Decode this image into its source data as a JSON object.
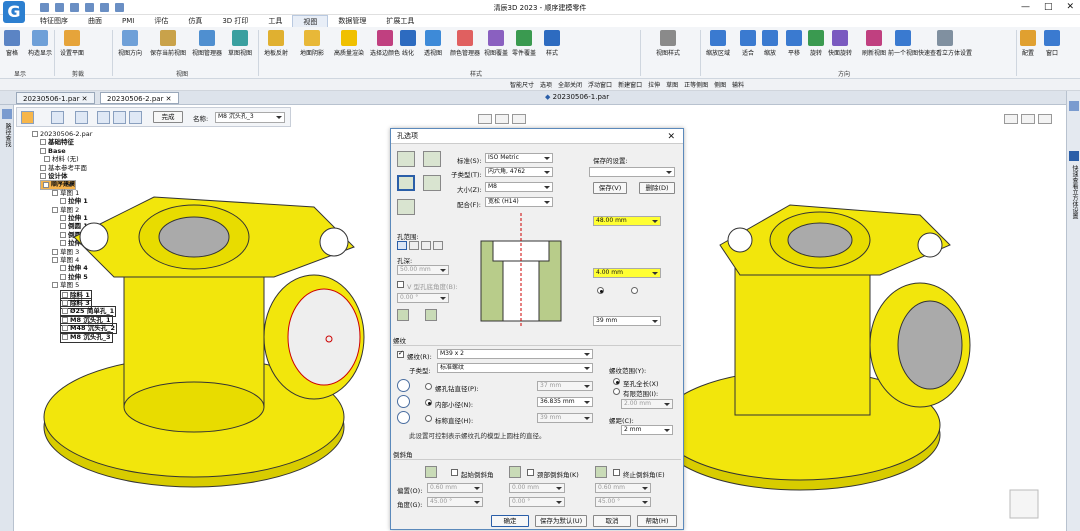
{
  "app": {
    "title": "清辰3D 2023 - 顺序建模零件",
    "logo": "G"
  },
  "tabs": [
    "特征图序",
    "曲面",
    "PMI",
    "评估",
    "仿真",
    "3D 打印",
    "工具",
    "视图",
    "数据管理",
    "扩展工具"
  ],
  "active_tab": "视图",
  "ribbon": {
    "buttons": [
      "窗格",
      "构造显示",
      "设置平面",
      "视图方向",
      "保存当前视图",
      "视图管理器",
      "草图视图",
      "地板反射",
      "地面阴影",
      "高质量渲染",
      "选择边颜色",
      "线化",
      "透视图",
      "颜色管理器",
      "视图覆盖",
      "零件覆盖",
      "样式",
      "视图样式",
      "缩放区域",
      "适合",
      "缩放",
      "平移",
      "旋转",
      "快面旋转",
      "刷新视图",
      "前一个视图",
      "快速查看立方体设置",
      "配置",
      "窗口"
    ],
    "groups": [
      "显示",
      "剪裁",
      "视图",
      "样式",
      "方向"
    ]
  },
  "cmdbar": [
    "智能尺寸",
    "选项",
    "全部关闭",
    "浮动窗口",
    "新建窗口",
    "拉伸",
    "草图",
    "正等侧图",
    "侧图",
    "输料"
  ],
  "doctabs": [
    "20230506-1.par",
    "20230506-2.par"
  ],
  "pathtool": {
    "done_label": "完成",
    "name_label": "名称:",
    "name_value": "M8 沉头孔_3"
  },
  "left_sidebar": "路径查找",
  "tree": [
    "20230506-2.par",
    "基础特征",
    "Base",
    "材料 (无)",
    "基本参考平面",
    "设计体",
    "顺序建模",
    "草图 1",
    "拉伸 1",
    "草图 2",
    "拉伸 1",
    "倒圆 1",
    "倒圆 2",
    "拉伸 2",
    "草图 3",
    "草图 4",
    "拉伸 4",
    "拉伸 5",
    "草图 5",
    "除料 1",
    "除料 3",
    "Ø25 简单孔_1",
    "M8 沉头孔_1",
    "M48 沉头孔_2",
    "M8 沉头孔_3"
  ],
  "view2_title": "20230506-1.par",
  "right_panel": "快速查看立方体设置",
  "dialog": {
    "title": "孔选项",
    "std_label": "标准(S):",
    "std_value": "ISO Metric",
    "subtype_label": "子类型(T):",
    "subtype_value": "内六角, 4762",
    "size_label": "大小(Z):",
    "size_value": "M8",
    "fit_label": "配合(F):",
    "fit_value": "宽松 (H14)",
    "saved_label": "保存的设置:",
    "save_btn": "保存(V)",
    "delete_btn": "删除(D)",
    "depth1": "48.00 mm",
    "depth2": "4.00 mm",
    "depth3": "39 mm",
    "range_label": "孔范围:",
    "depth_label": "孔深:",
    "depth_value": "50.00 mm",
    "vangle_label": "V 型孔底角度(B):",
    "vangle_value": "0.00 °",
    "thread_section": "螺纹",
    "thread_chk": "螺纹(R):",
    "thread_value": "M39 x 2",
    "thread_sub_label": "子类型:",
    "thread_sub_value": "标准螺纹",
    "tap_label": "螺孔钻直径(P):",
    "tap_value": "37 mm",
    "minor_label": "内部小径(N):",
    "minor_value": "36.835 mm",
    "nominal_label": "标称直径(H):",
    "nominal_value": "39 mm",
    "note": "此设置可控制表示螺纹孔的模型上圆柱的直径。",
    "thread_range_label": "螺纹范围(Y):",
    "full_label": "至孔全长(X)",
    "finite_label": "有限范围(I):",
    "finite_value": "2.00 mm",
    "pitch_label": "螺距(C):",
    "pitch_value": "2 mm",
    "chamfer_section": "倒斜角",
    "start_chamfer": "起始倒斜角",
    "neck_chamfer": "颈部倒斜角(K)",
    "end_chamfer": "终止倒斜角(E)",
    "offset_label": "偏置(O):",
    "angle_label": "角度(G):",
    "off1": "0.60 mm",
    "off2": "0.00 mm",
    "off3": "0.60 mm",
    "ang1": "45.00 °",
    "ang2": "0.00 °",
    "ang3": "45.00 °",
    "ok": "确定",
    "save_default": "保存为默认(U)",
    "cancel": "取消",
    "help": "帮助(H)"
  },
  "colors": {
    "part": "#f2e60c",
    "accent": "#2a5ea8",
    "highlight": "#ffff33"
  }
}
